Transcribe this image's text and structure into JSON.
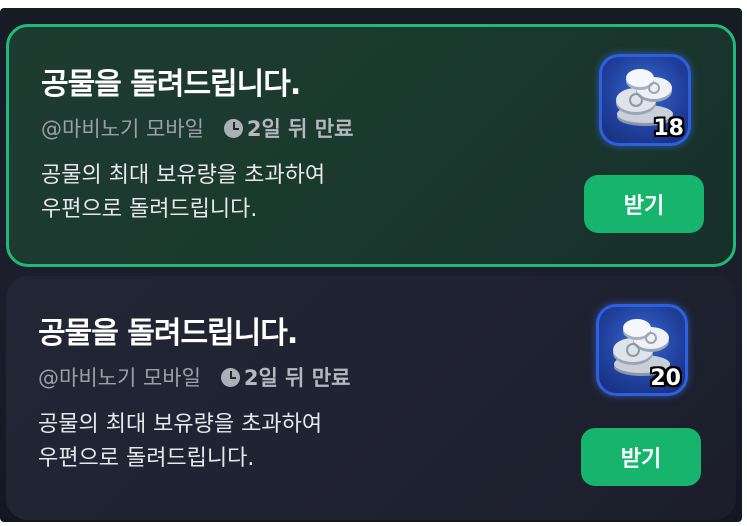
{
  "mails": [
    {
      "title": "공물을 돌려드립니다.",
      "sender": "@마비노기 모바일",
      "expiry": "2일 뒤 만료",
      "body_line1": "공물의 최대 보유량을 초과하여",
      "body_line2": "우편으로 돌려드립니다.",
      "item_icon": "silver-coins-icon",
      "item_count": "18",
      "claim_label": "받기",
      "selected": true
    },
    {
      "title": "공물을 돌려드립니다.",
      "sender": "@마비노기 모바일",
      "expiry": "2일 뒤 만료",
      "body_line1": "공물의 최대 보유량을 초과하여",
      "body_line2": "우편으로 돌려드립니다.",
      "item_icon": "silver-coins-icon",
      "item_count": "20",
      "claim_label": "받기",
      "selected": false
    }
  ],
  "colors": {
    "accent_green": "#17b46d",
    "selected_border": "#1fb978",
    "icon_blue": "#2d5fe0"
  }
}
